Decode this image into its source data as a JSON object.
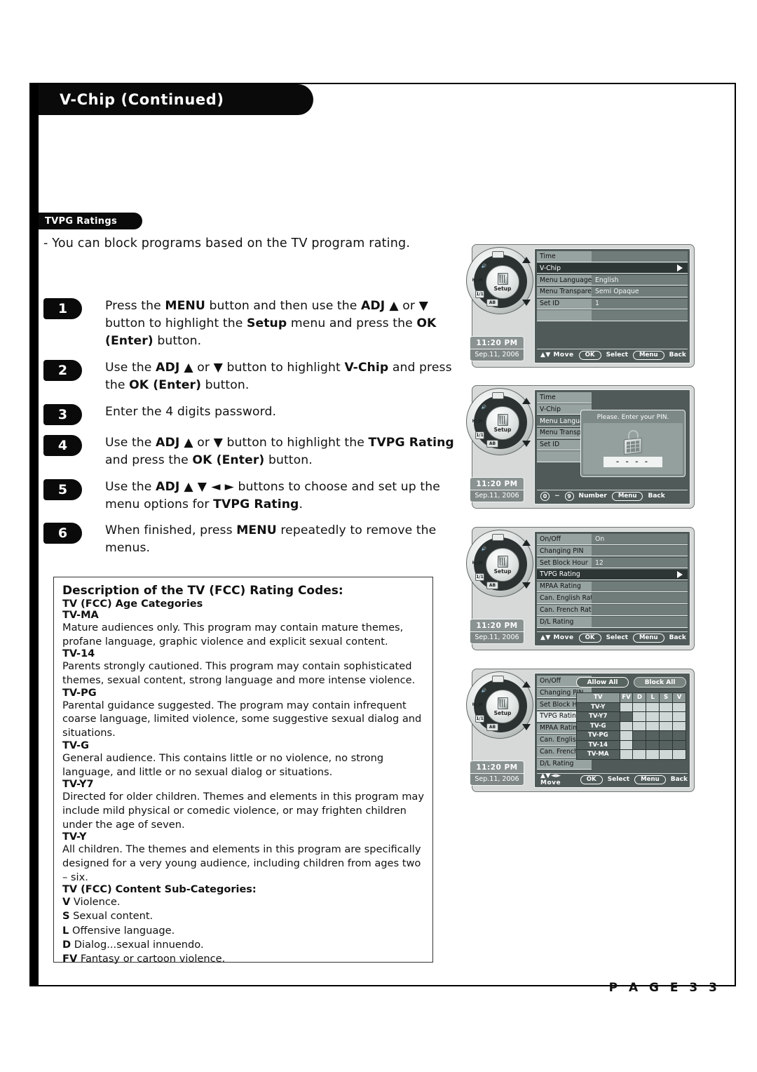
{
  "header": {
    "title": "V-Chip (Continued)"
  },
  "section": {
    "title": "TVPG Ratings"
  },
  "intro": "- You can block programs based on the TV program rating.",
  "steps": [
    {
      "num": "1",
      "html": "Press the <b>MENU</b> button and then use the <b>ADJ ▲</b> or <b>▼</b> button to highlight the <b>Setup</b> menu and press the <b>OK (Enter)</b> button."
    },
    {
      "num": "2",
      "html": "Use the <b>ADJ ▲</b> or <b>▼</b> button to highlight <b>V-Chip</b> and press the <b>OK (Enter)</b> button."
    },
    {
      "num": "3",
      "html": "Enter the 4 digits password."
    },
    {
      "num": "4",
      "html": "Use the <b>ADJ ▲</b> or <b>▼</b> button to highlight the <b>TVPG Rating</b> and press the <b>OK (Enter)</b> button."
    },
    {
      "num": "5",
      "html": "Use the <b>ADJ ▲ ▼ ◄ ►</b> buttons to choose and set up the menu options for <b>TVPG Rating</b>."
    },
    {
      "num": "6",
      "html": "When finished, press <b>MENU</b> repeatedly to remove the menus."
    }
  ],
  "description": {
    "title": "Description of the TV (FCC) Rating Codes:",
    "age_categories_heading": "TV (FCC) Age Categories",
    "ratings": [
      {
        "code": "TV-MA",
        "text": "Mature audiences only. This program may contain mature themes, profane language, graphic violence and explicit sexual content."
      },
      {
        "code": "TV-14",
        "text": "Parents strongly cautioned. This program may contain sophisticated themes, sexual content, strong language and more intense violence."
      },
      {
        "code": "TV-PG",
        "text": "Parental guidance suggested. The program may contain infrequent coarse language, limited violence, some suggestive sexual dialog and situations."
      },
      {
        "code": "TV-G",
        "text": "General audience. This contains little or no violence, no strong language, and little or no sexual dialog or situations."
      },
      {
        "code": "TV-Y7",
        "text": "Directed for older children. Themes and elements in this program may include mild physical or comedic violence, or may frighten children under the age of seven."
      },
      {
        "code": "TV-Y",
        "text": "All children. The themes and elements in this program are specifically designed for a very young audience, including children from ages two – six."
      }
    ],
    "sub_categories_heading": "TV (FCC) Content Sub-Categories:",
    "sub_categories": [
      {
        "code": "V",
        "text": "Violence."
      },
      {
        "code": "S",
        "text": "Sexual content."
      },
      {
        "code": "L",
        "text": "Offensive language."
      },
      {
        "code": "D",
        "text": "Dialog...sexual innuendo."
      },
      {
        "code": "FV",
        "text": "Fantasy or cartoon violence."
      }
    ]
  },
  "page_number": "P A G E   3 3",
  "remote": {
    "center_label": "Setup",
    "clock_time": "11:20 PM",
    "clock_date": "Sep.11, 2006",
    "ab_label": "AB"
  },
  "panels": [
    {
      "id": "setup-menu",
      "rows": [
        {
          "label": "Time",
          "value": "",
          "selected": false
        },
        {
          "label": "V-Chip",
          "value": "",
          "selected": true,
          "arrow": true
        },
        {
          "label": "Menu Language",
          "value": "English",
          "selected": false
        },
        {
          "label": "Menu Transparency",
          "value": "Semi Opaque",
          "selected": false
        },
        {
          "label": "Set ID",
          "value": "1",
          "selected": false
        },
        {
          "label": "",
          "value": "",
          "selected": false
        }
      ],
      "hint": {
        "move": "▲▼ Move",
        "ok": "OK",
        "select": "Select",
        "menu": "Menu",
        "back": "Back"
      }
    },
    {
      "id": "pin-entry",
      "labels": [
        "Time",
        "V-Chip",
        "Menu Language",
        "Menu Transparency",
        "Set ID",
        ""
      ],
      "highlight_index": 2,
      "dialog": {
        "title": "Please. Enter your PIN.",
        "field_value": "- - - -"
      },
      "hint": {
        "range_from": "0",
        "range_to": "9",
        "number": "Number",
        "menu": "Menu",
        "back": "Back",
        "tilde": "~"
      }
    },
    {
      "id": "vchip-menu",
      "rows": [
        {
          "label": "On/Off",
          "value": "On",
          "selected": false
        },
        {
          "label": "Changing PIN",
          "value": "",
          "selected": false
        },
        {
          "label": "Set Block Hour",
          "value": "12",
          "selected": false
        },
        {
          "label": "TVPG Rating",
          "value": "",
          "selected": true,
          "arrow": true
        },
        {
          "label": "MPAA Rating",
          "value": "",
          "selected": false
        },
        {
          "label": "Can. English Rating",
          "value": "",
          "selected": false
        },
        {
          "label": "Can. French Rating",
          "value": "",
          "selected": false
        },
        {
          "label": "D/L Rating",
          "value": "",
          "selected": false
        }
      ],
      "hint": {
        "move": "▲▼ Move",
        "ok": "OK",
        "select": "Select",
        "menu": "Menu",
        "back": "Back"
      }
    },
    {
      "id": "tvpg-grid",
      "labels": [
        "On/Off",
        "Changing PIN",
        "Set Block Hour",
        "TVPG Rating",
        "MPAA Rating",
        "Can. English Rating",
        "Can. French Rating",
        "D/L Rating"
      ],
      "selected_index": 3,
      "buttons": {
        "allow_all": "Allow All",
        "block_all": "Block All"
      },
      "grid": {
        "corner": "TV",
        "columns": [
          "FV",
          "D",
          "L",
          "S",
          "V"
        ],
        "rows": [
          {
            "name": "TV-Y",
            "cells": [
              "light",
              "light",
              "light",
              "light",
              "light"
            ]
          },
          {
            "name": "TV-Y7",
            "cells": [
              "dark",
              "light",
              "light",
              "light",
              "light"
            ]
          },
          {
            "name": "TV-G",
            "cells": [
              "light",
              "light",
              "light",
              "light",
              "light"
            ]
          },
          {
            "name": "TV-PG",
            "cells": [
              "light",
              "dark",
              "dark",
              "dark",
              "dark"
            ]
          },
          {
            "name": "TV-14",
            "cells": [
              "light",
              "dark",
              "dark",
              "dark",
              "dark"
            ]
          },
          {
            "name": "TV-MA",
            "cells": [
              "light",
              "light",
              "light",
              "light",
              "light"
            ]
          }
        ]
      },
      "hint": {
        "move": "▲▼◄► Move",
        "ok": "OK",
        "select": "Select",
        "menu": "Menu",
        "back": "Back"
      }
    }
  ],
  "colors": {
    "black": "#0a0a0a",
    "osd_bg": "#4f5a59",
    "osd_label": "#97a3a1",
    "osd_selected": "#2d3635",
    "panel_bg": "#d6d9d8"
  }
}
